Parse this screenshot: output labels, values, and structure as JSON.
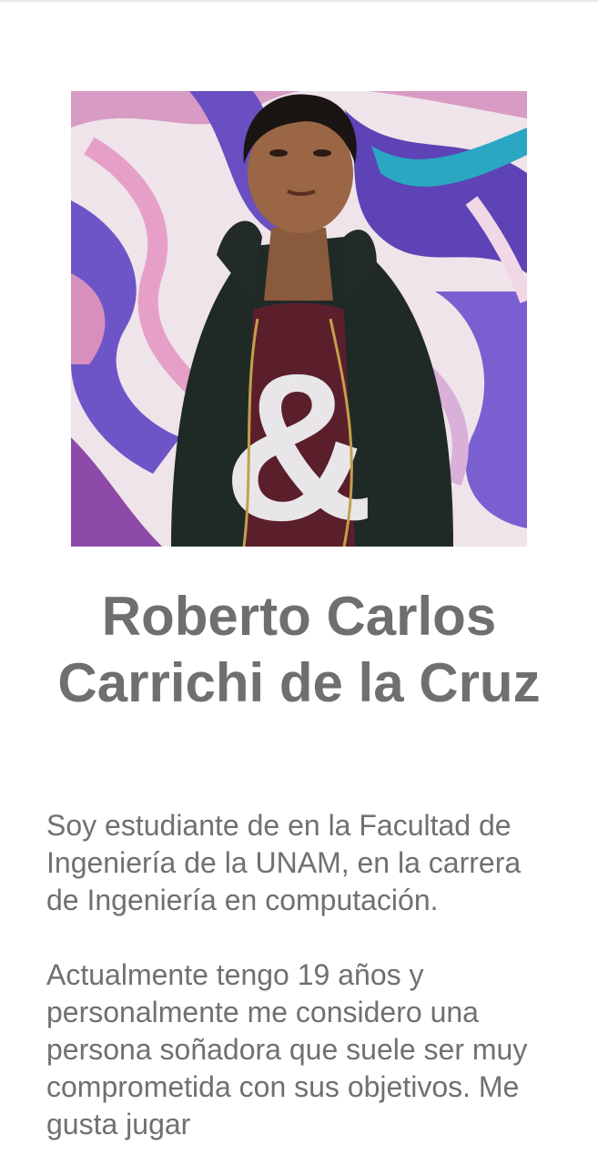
{
  "profile": {
    "name_line1": "Roberto Carlos",
    "name_line2": "Carrichi de la Cruz",
    "bio": [
      "Soy estudiante de en la Facultad de Ingeniería de la UNAM, en la carrera de Ingeniería en computación.",
      "Actualmente tengo 19 años y personalmente me considero una persona soñadora que suele ser muy comprometida con sus objetivos. Me gusta jugar"
    ]
  },
  "colors": {
    "text": "#707070",
    "background": "#ffffff"
  }
}
